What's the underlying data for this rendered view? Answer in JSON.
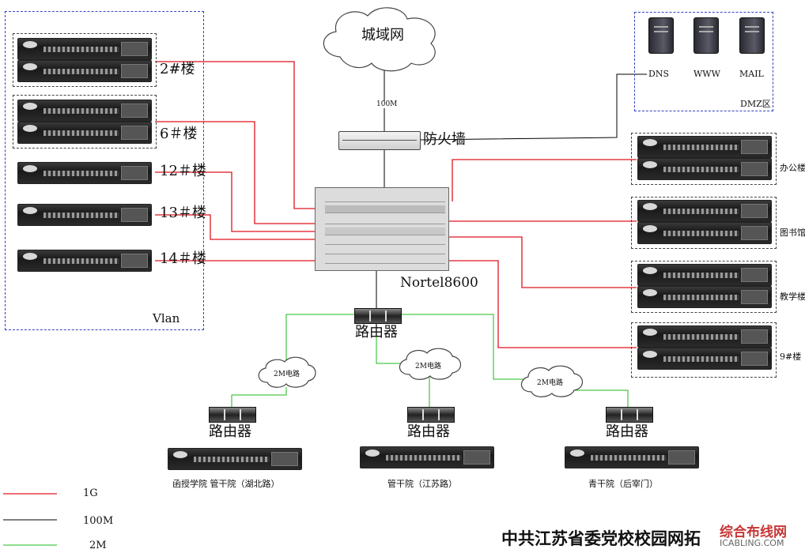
{
  "wan": {
    "label": "城域网",
    "link_label": "100M"
  },
  "firewall": {
    "label": "防火墙"
  },
  "core": {
    "label": "Nortel8600"
  },
  "core_router": {
    "label": "路由器"
  },
  "dmz": {
    "label": "DMZ区",
    "servers": [
      "DNS",
      "WWW",
      "MAIL"
    ]
  },
  "vlan": {
    "label": "Vlan",
    "buildings": [
      "2#楼",
      "6＃楼",
      "12＃楼",
      "13＃楼",
      "14＃楼"
    ]
  },
  "right_buildings": [
    "办公楼",
    "图书馆",
    "教学楼",
    "9#楼"
  ],
  "circuits": [
    "2M电路",
    "2M电路",
    "2M电路"
  ],
  "branch_router_label": "路由器",
  "branches": [
    "函授学院 管干院（湖北路）",
    "管干院（江苏路）",
    "青干院（后宰门）"
  ],
  "legend": [
    {
      "label": "1G",
      "color": "#e0141e"
    },
    {
      "label": "100M",
      "color": "#000000"
    },
    {
      "label": "2M",
      "color": "#1db81d"
    }
  ],
  "title": "中共江苏省委党校校园网拓",
  "watermark": {
    "line1": "综合布线网",
    "line2": "ICABLING.COM"
  }
}
